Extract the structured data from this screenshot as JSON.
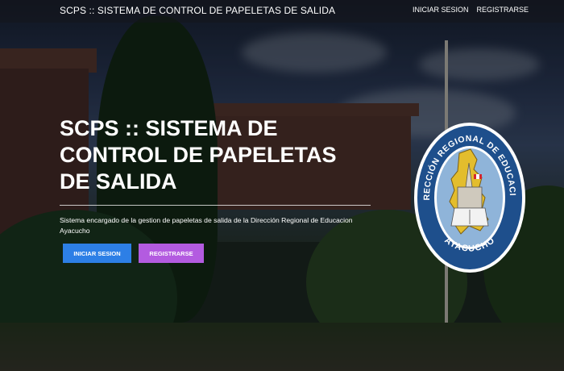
{
  "navbar": {
    "brand": "SCPS :: SISTEMA DE CONTROL DE PAPELETAS DE SALIDA",
    "links": [
      "INICIAR SESION",
      "REGISTRARSE"
    ]
  },
  "hero": {
    "title_lines": [
      "SCPS :: SISTEMA DE",
      "CONTROL DE PAPELETAS",
      "DE SALIDA"
    ],
    "description": "Sistema encargado de la gestion de papeletas de salida de la Dirección Regional de Educacion Ayacucho",
    "buttons": {
      "login": "INICIAR SESION",
      "register": "REGISTRARSE"
    }
  },
  "seal": {
    "top_text": "DIRECCIÓN REGIONAL DE EDUCACIÓN",
    "bottom_text": "AYACUCHO"
  },
  "colors": {
    "login_button": "#2d7fe6",
    "register_button": "#b35be0",
    "seal_ring": "#1e4f8c",
    "seal_inner": "#8fb4d9",
    "seal_map": "#e3bd2d"
  }
}
